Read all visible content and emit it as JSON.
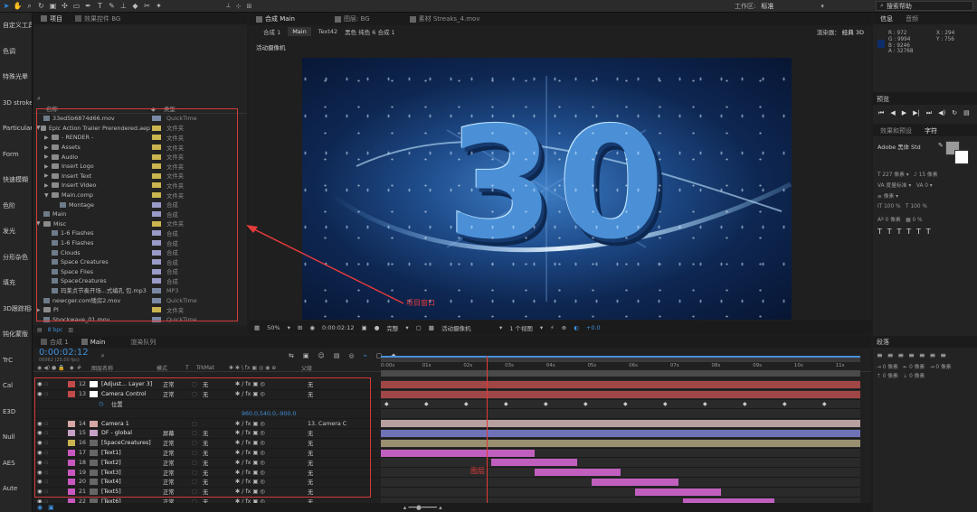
{
  "toolbar": {
    "workspace_label": "工作区:",
    "workspace_value": "标准",
    "search_placeholder": "搜索帮助"
  },
  "left_sidebar": {
    "items": [
      "自定义工具",
      "色调",
      "特殊光晕",
      "3D stroke",
      "Particular",
      "Form",
      "快速模糊",
      "色阶",
      "发光",
      "分形杂色",
      "填充",
      "3D跟踪相机",
      "钝化蒙版",
      "TrC",
      "Cal",
      "E3D",
      "Null",
      "AES",
      "Aute"
    ]
  },
  "project_panel": {
    "tabs": [
      "项目",
      "效果控件 BG"
    ],
    "col_name": "名称",
    "col_type": "类型",
    "rows": [
      {
        "indent": 0,
        "tri": "",
        "kind": "file",
        "name": "33ed5b6874d66.mov",
        "type": "QuickTime",
        "color": "#7a8aa6"
      },
      {
        "indent": 0,
        "tri": "▼",
        "kind": "folder",
        "name": "Epic Action Trailer Prerendered.aep",
        "type": "文件夹",
        "color": "#c9b44f"
      },
      {
        "indent": 1,
        "tri": "▶",
        "kind": "folder",
        "name": "- RENDER -",
        "type": "文件夹",
        "color": "#c9b44f"
      },
      {
        "indent": 1,
        "tri": "▶",
        "kind": "folder",
        "name": "Assets",
        "type": "文件夹",
        "color": "#c9b44f"
      },
      {
        "indent": 1,
        "tri": "▶",
        "kind": "folder",
        "name": "Audio",
        "type": "文件夹",
        "color": "#c9b44f"
      },
      {
        "indent": 1,
        "tri": "▶",
        "kind": "folder",
        "name": "Insert Logo",
        "type": "文件夹",
        "color": "#c9b44f"
      },
      {
        "indent": 1,
        "tri": "▶",
        "kind": "folder",
        "name": "Insert Text",
        "type": "文件夹",
        "color": "#c9b44f"
      },
      {
        "indent": 1,
        "tri": "▶",
        "kind": "folder",
        "name": "Insert Video",
        "type": "文件夹",
        "color": "#c9b44f"
      },
      {
        "indent": 1,
        "tri": "▼",
        "kind": "folder",
        "name": "Main.comp",
        "type": "文件夹",
        "color": "#c9b44f"
      },
      {
        "indent": 2,
        "tri": "",
        "kind": "file",
        "name": "Montage",
        "type": "合成",
        "color": "#9a9ac8"
      },
      {
        "indent": 0,
        "tri": "",
        "kind": "file",
        "name": "Main",
        "type": "合成",
        "color": "#9a9ac8"
      },
      {
        "indent": 0,
        "tri": "▼",
        "kind": "folder",
        "name": "Misc",
        "type": "文件夹",
        "color": "#c9b44f"
      },
      {
        "indent": 1,
        "tri": "",
        "kind": "file",
        "name": "1-6 Flashes",
        "type": "合成",
        "color": "#9a9ac8"
      },
      {
        "indent": 1,
        "tri": "",
        "kind": "file",
        "name": "1-6 Flashes",
        "type": "合成",
        "color": "#9a9ac8"
      },
      {
        "indent": 1,
        "tri": "",
        "kind": "file",
        "name": "Clouds",
        "type": "合成",
        "color": "#9a9ac8"
      },
      {
        "indent": 1,
        "tri": "",
        "kind": "file",
        "name": "Space Creatures",
        "type": "合成",
        "color": "#9a9ac8"
      },
      {
        "indent": 1,
        "tri": "",
        "kind": "file",
        "name": "Space Flies",
        "type": "合成",
        "color": "#9a9ac8"
      },
      {
        "indent": 1,
        "tri": "",
        "kind": "file",
        "name": "SpaceCreatures",
        "type": "合成",
        "color": "#9a9ac8"
      },
      {
        "indent": 1,
        "tri": "",
        "kind": "file",
        "name": "玛莱贞节奏开场...式编孔 包.mp3",
        "type": "MP3",
        "color": "#7a8aa6"
      },
      {
        "indent": 0,
        "tri": "",
        "kind": "file",
        "name": "newcger.com矮房2.mov",
        "type": "QuickTime",
        "color": "#7a8aa6"
      },
      {
        "indent": 0,
        "tri": "▶",
        "kind": "folder",
        "name": "PI",
        "type": "文件夹",
        "color": "#c9b44f"
      },
      {
        "indent": 0,
        "tri": "",
        "kind": "file",
        "name": "Shockwave_01.mov",
        "type": "QuickTime",
        "color": "#7a8aa6"
      }
    ],
    "bpc_label": "8 bpc",
    "annotation": "项目窗口"
  },
  "composition_panel": {
    "tabs": [
      "合成 Main",
      "图层: BG",
      "素材 Streaks_4.mov"
    ],
    "breadcrumbs": [
      "合成 1",
      "Main",
      "Text42",
      "黑色 纯色 6 合成 1"
    ],
    "renderer_label": "渲染器：",
    "renderer_value": "经典 3D",
    "camera_label": "活动摄像机",
    "preview_number": "30",
    "zoom": "50%",
    "timecode": "0:00:02:12",
    "resolution": "完整",
    "view_camera": "活动摄像机",
    "views": "1 个视图",
    "offset": "+0.0"
  },
  "info_panel": {
    "tabs": [
      "信息",
      "音频"
    ],
    "r": "R : 972",
    "g": "G : 9994",
    "b": "B : 9246",
    "a": "A : 32768",
    "x": "X : 294",
    "y": "Y : 756"
  },
  "preview_panel": {
    "title": "预览"
  },
  "character_panel": {
    "tabs": [
      "效果和预设",
      "字符"
    ],
    "font": "Adobe 黑体 Std",
    "size_unit": "像素",
    "scale_h": "100 %",
    "scale_v": "100 %",
    "baseline": "0 像素",
    "tsume": "0 %"
  },
  "paragraph_panel": {
    "title": "段落",
    "indent_1": "0 像素",
    "indent_2": "0 像素",
    "indent_3": "0 像素",
    "space_1": "0 像素",
    "space_2": "0 像素"
  },
  "timeline": {
    "tabs": [
      "合成 1",
      "Main",
      "渲染队列"
    ],
    "timecode": "0:00:02:12",
    "fps": "00062 (25.00 fps)",
    "headers": {
      "num": "#",
      "name": "图层名称",
      "mode": "模式",
      "t": "T",
      "trkmat": "TrkMat",
      "parent": "父级"
    },
    "ruler": [
      "0:00s",
      "01s",
      "02s",
      "03s",
      "04s",
      "05s",
      "06s",
      "07s",
      "08s",
      "09s",
      "10s",
      "11s"
    ],
    "position_label": "位置",
    "position_value": "960.0,540.0,-900.0",
    "layers": [
      {
        "num": "12",
        "name": "[Adjust... Layer 3]",
        "mode": "正常",
        "trk": "无",
        "parent": "无",
        "color": "#c24a4a",
        "swatch": "#ffffff",
        "bar": "#a14646",
        "bar_start": 0,
        "bar_end": 1
      },
      {
        "num": "13",
        "name": "Camera Control",
        "mode": "正常",
        "trk": "无",
        "parent": "无",
        "color": "#c24a4a",
        "swatch": "#ffffff",
        "bar": "#a14646",
        "bar_start": 0,
        "bar_end": 1
      },
      {
        "num": "14",
        "name": "Camera 1",
        "mode": "",
        "trk": "",
        "parent": "13. Camera C",
        "color": "#d6a6a6",
        "swatch": "#d6a6a6",
        "bar": "#b8a0a0",
        "bar_start": 0,
        "bar_end": 1
      },
      {
        "num": "15",
        "name": "DF - global",
        "mode": "屏幕",
        "trk": "无",
        "parent": "无",
        "color": "#c6a0c6",
        "swatch": "#c6a0c6",
        "bar": "#7072b8",
        "bar_start": 0,
        "bar_end": 1
      },
      {
        "num": "16",
        "name": "[SpaceCreatures]",
        "mode": "正常",
        "trk": "无",
        "parent": "无",
        "color": "#c9b44f",
        "swatch": "#666",
        "bar": "#9a8f70",
        "bar_start": 0,
        "bar_end": 1
      },
      {
        "num": "17",
        "name": "[Text1]",
        "mode": "正常",
        "trk": "无",
        "parent": "无",
        "color": "#c858c0",
        "swatch": "#666",
        "bar": "#c15fbf",
        "bar_start": 0,
        "bar_end": 0.32
      },
      {
        "num": "18",
        "name": "[Text2]",
        "mode": "正常",
        "trk": "无",
        "parent": "无",
        "color": "#c858c0",
        "swatch": "#666",
        "bar": "#c15fbf",
        "bar_start": 0.23,
        "bar_end": 0.41
      },
      {
        "num": "19",
        "name": "[Text3]",
        "mode": "正常",
        "trk": "无",
        "parent": "无",
        "color": "#c858c0",
        "swatch": "#666",
        "bar": "#c15fbf",
        "bar_start": 0.32,
        "bar_end": 0.5
      },
      {
        "num": "20",
        "name": "[Text4]",
        "mode": "正常",
        "trk": "无",
        "parent": "无",
        "color": "#c858c0",
        "swatch": "#666",
        "bar": "#c15fbf",
        "bar_start": 0.44,
        "bar_end": 0.62
      },
      {
        "num": "21",
        "name": "[Text5]",
        "mode": "正常",
        "trk": "无",
        "parent": "无",
        "color": "#c858c0",
        "swatch": "#666",
        "bar": "#c15fbf",
        "bar_start": 0.53,
        "bar_end": 0.71
      },
      {
        "num": "22",
        "name": "[Text6]",
        "mode": "正常",
        "trk": "无",
        "parent": "无",
        "color": "#c858c0",
        "swatch": "#666",
        "bar": "#c15fbf",
        "bar_start": 0.63,
        "bar_end": 0.82
      }
    ],
    "playhead_fraction": 0.22,
    "annotation": "图层"
  },
  "colors": {
    "accent_blue": "#2d8ceb",
    "annotation_red": "#d43a3a",
    "panel_bg": "#232323"
  }
}
